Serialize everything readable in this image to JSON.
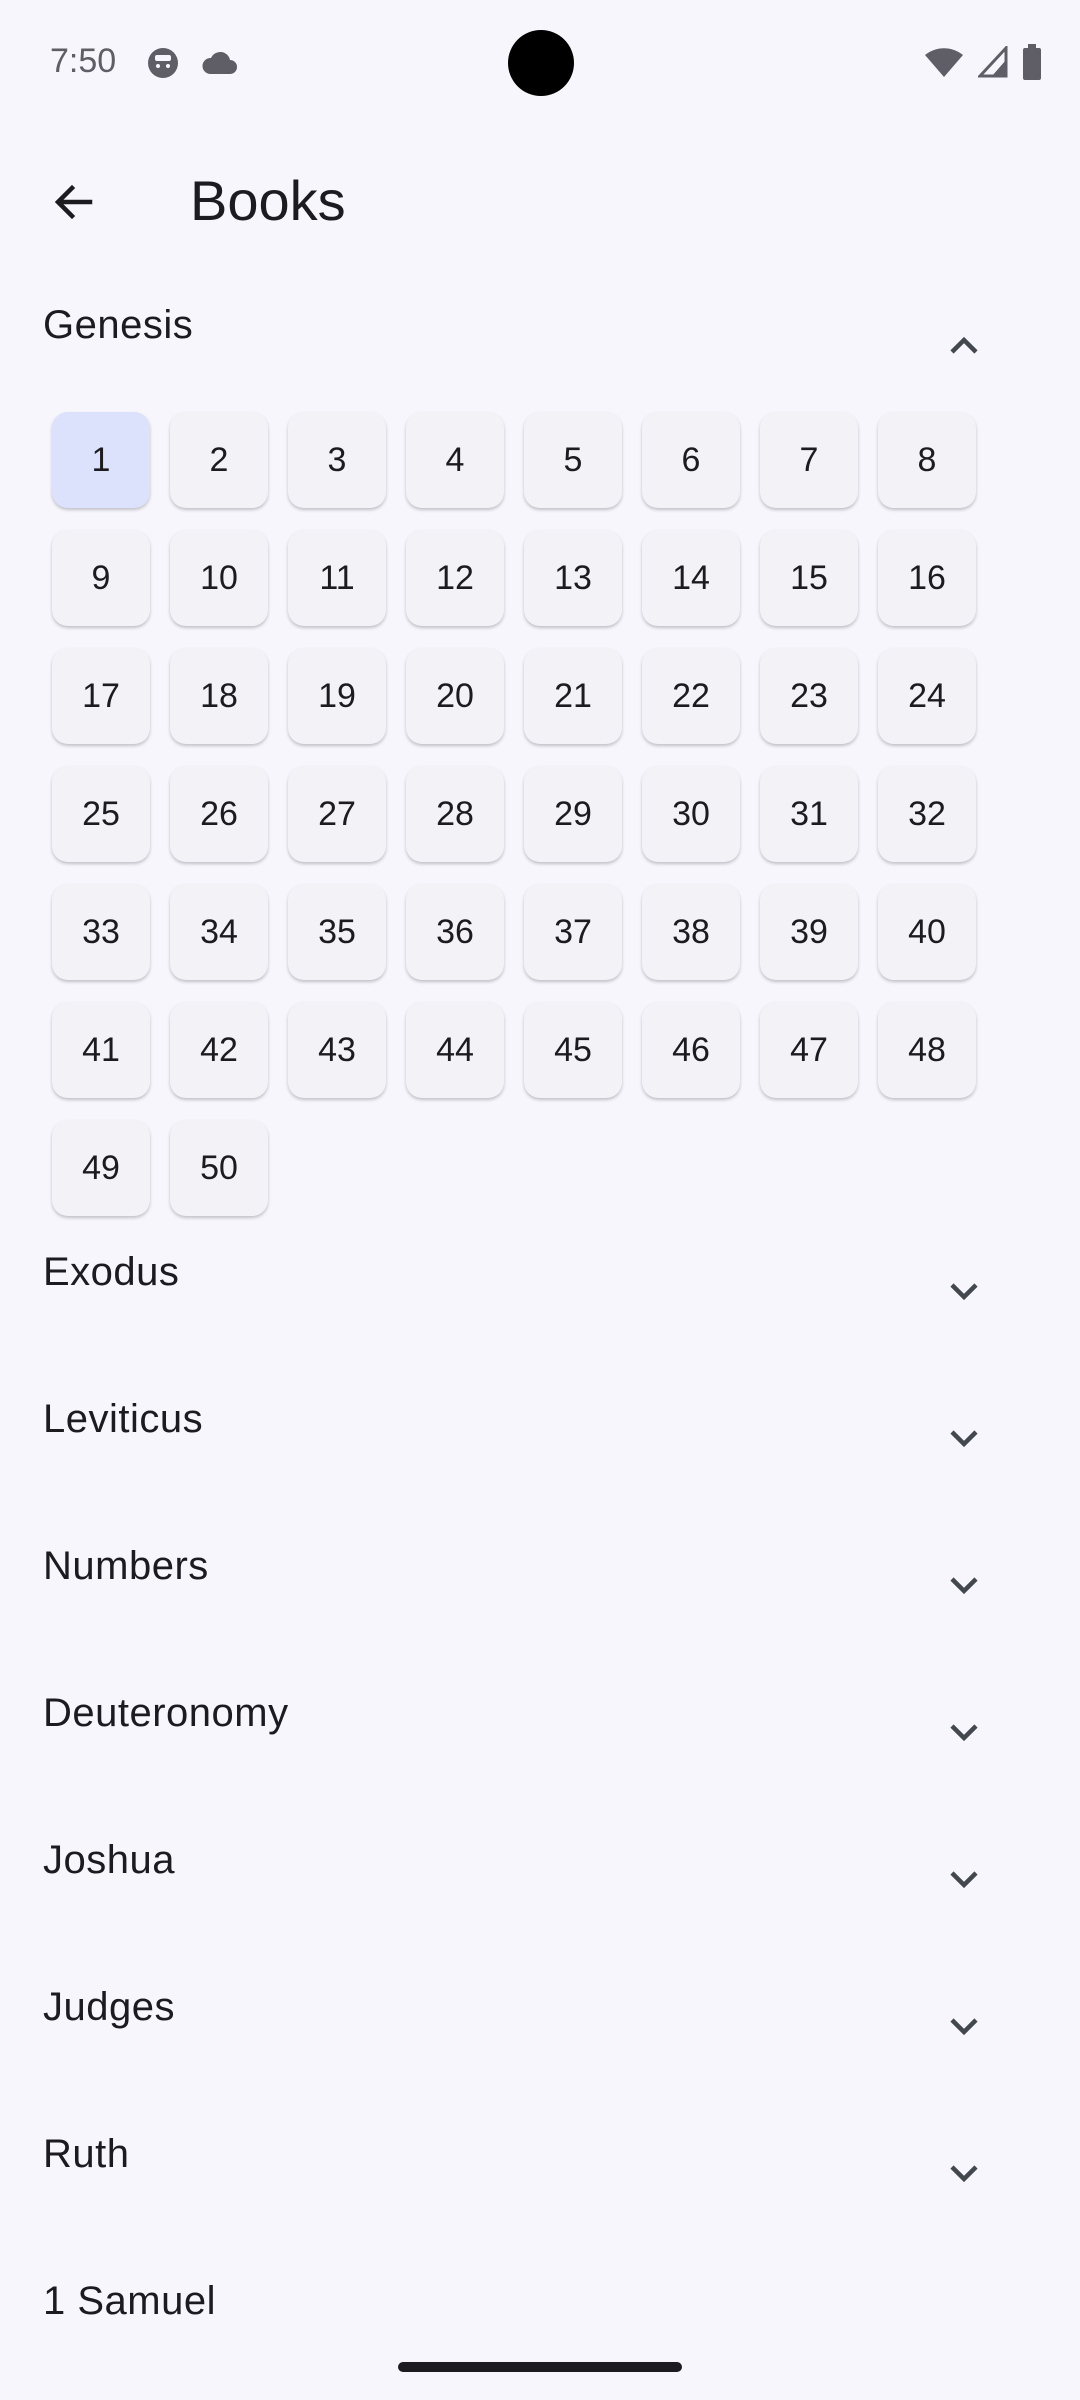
{
  "status_bar": {
    "time": "7:50",
    "left_icons": [
      "face-notification-icon",
      "cloud-icon"
    ],
    "right_icons": [
      "wifi-icon",
      "cell-signal-icon",
      "battery-icon"
    ]
  },
  "app_bar": {
    "title": "Books",
    "back_icon": "arrow-back-icon"
  },
  "books": [
    {
      "name": "Genesis",
      "expanded": true,
      "chapters_count": 50,
      "selected_chapter": 1
    },
    {
      "name": "Exodus",
      "expanded": false
    },
    {
      "name": "Leviticus",
      "expanded": false
    },
    {
      "name": "Numbers",
      "expanded": false
    },
    {
      "name": "Deuteronomy",
      "expanded": false
    },
    {
      "name": "Joshua",
      "expanded": false
    },
    {
      "name": "Judges",
      "expanded": false
    },
    {
      "name": "Ruth",
      "expanded": false
    },
    {
      "name": "1 Samuel",
      "expanded": false
    }
  ],
  "chapters": [
    "1",
    "2",
    "3",
    "4",
    "5",
    "6",
    "7",
    "8",
    "9",
    "10",
    "11",
    "12",
    "13",
    "14",
    "15",
    "16",
    "17",
    "18",
    "19",
    "20",
    "21",
    "22",
    "23",
    "24",
    "25",
    "26",
    "27",
    "28",
    "29",
    "30",
    "31",
    "32",
    "33",
    "34",
    "35",
    "36",
    "37",
    "38",
    "39",
    "40",
    "41",
    "42",
    "43",
    "44",
    "45",
    "46",
    "47",
    "48",
    "49",
    "50"
  ],
  "colors": {
    "background": "#F7F6FD",
    "chip": "#F3F2F7",
    "chip_selected": "#DCE2FB",
    "text": "#1C1B1F"
  }
}
